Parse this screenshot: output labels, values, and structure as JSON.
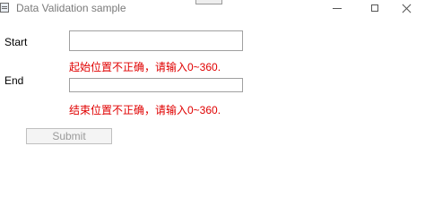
{
  "window": {
    "title": "Data Validation sample",
    "app_icon": "window-app-icon",
    "controls": {
      "minimize_icon": "minimize-icon",
      "maximize_icon": "maximize-icon",
      "close_icon": "close-icon"
    }
  },
  "form": {
    "start_label": "Start",
    "start_value": "",
    "start_error": "起始位置不正确，请输入0~360.",
    "end_label": "End",
    "end_value": "",
    "end_error": "结束位置不正确，请输入0~360.",
    "submit_label": "Submit",
    "submit_enabled": false
  },
  "colors": {
    "error_text": "#e00000",
    "disabled_text": "#9a9a9a",
    "input_border": "#a0a0a0"
  }
}
